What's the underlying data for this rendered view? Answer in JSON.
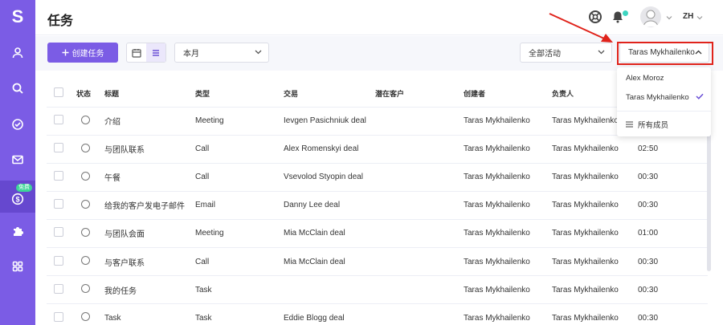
{
  "app": {
    "logo_letter": "S",
    "page_title": "任务",
    "user_initials": "ZH",
    "accent_color": "#7b5ce5"
  },
  "sidebar": {
    "items": [
      {
        "icon": "user-icon"
      },
      {
        "icon": "search-icon"
      },
      {
        "icon": "check-circle-icon"
      },
      {
        "icon": "mail-icon"
      },
      {
        "icon": "dollar-icon",
        "badge": "免费",
        "active": true
      },
      {
        "icon": "puzzle-icon"
      },
      {
        "icon": "grid-icon"
      }
    ]
  },
  "toolbar": {
    "create_label": "创建任务",
    "period_value": "本月",
    "activity_value": "全部活动",
    "owner_value": "Taras Mykhailenko"
  },
  "owner_dropdown": {
    "options": [
      {
        "label": "Alex Moroz"
      },
      {
        "label": "Taras Mykhailenko",
        "selected": true
      },
      {
        "label": "所有成员"
      }
    ]
  },
  "table": {
    "columns": [
      "状态",
      "标题",
      "类型",
      "交易",
      "潜在客户",
      "创建者",
      "负责人"
    ],
    "rows": [
      {
        "title": "介绍",
        "type": "Meeting",
        "deal": "Ievgen Pasichniuk deal",
        "lead": "",
        "creator": "Taras Mykhailenko",
        "owner": "Taras Mykhailenko",
        "time": ""
      },
      {
        "title": "与团队联系",
        "type": "Call",
        "deal": "Alex Romenskyi deal",
        "lead": "",
        "creator": "Taras Mykhailenko",
        "owner": "Taras Mykhailenko",
        "time": "02:50"
      },
      {
        "title": "午餐",
        "type": "Call",
        "deal": "Vsevolod Styopin deal",
        "lead": "",
        "creator": "Taras Mykhailenko",
        "owner": "Taras Mykhailenko",
        "time": "00:30"
      },
      {
        "title": "给我的客户发电子邮件",
        "type": "Email",
        "deal": "Danny Lee deal",
        "lead": "",
        "creator": "Taras Mykhailenko",
        "owner": "Taras Mykhailenko",
        "time": "00:30"
      },
      {
        "title": "与团队会面",
        "type": "Meeting",
        "deal": "Mia McClain deal",
        "lead": "",
        "creator": "Taras Mykhailenko",
        "owner": "Taras Mykhailenko",
        "time": "01:00"
      },
      {
        "title": "与客户联系",
        "type": "Call",
        "deal": "Mia McClain deal",
        "lead": "",
        "creator": "Taras Mykhailenko",
        "owner": "Taras Mykhailenko",
        "time": "00:30"
      },
      {
        "title": "我的任务",
        "type": "Task",
        "deal": "",
        "lead": "",
        "creator": "Taras Mykhailenko",
        "owner": "Taras Mykhailenko",
        "time": "00:30"
      },
      {
        "title": "Task",
        "type": "Task",
        "deal": "Eddie Blogg deal",
        "lead": "",
        "creator": "Taras Mykhailenko",
        "owner": "Taras Mykhailenko",
        "time": "00:30"
      }
    ]
  }
}
